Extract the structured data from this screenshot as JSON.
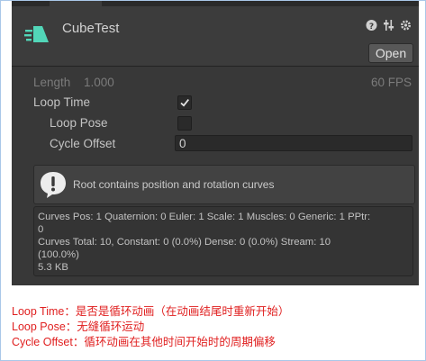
{
  "header": {
    "clip_name": "CubeTest",
    "clip_icon": "animation-clip-icon",
    "icons": [
      "help-icon",
      "preset-icon",
      "gear-icon"
    ],
    "open_label": "Open"
  },
  "length": {
    "label": "Length",
    "value": "1.000",
    "fps": "60 FPS"
  },
  "loop_time": {
    "label": "Loop Time",
    "checked": true
  },
  "loop_pose": {
    "label": "Loop Pose",
    "checked": false
  },
  "cycle_offset": {
    "label": "Cycle Offset",
    "value": "0"
  },
  "help": {
    "text": "Root contains position and rotation curves"
  },
  "info": {
    "line1": "Curves Pos: 1 Quaternion: 0 Euler: 1 Scale: 1 Muscles: 0 Generic: 1 PPtr:\n0",
    "line2": "Curves Total: 10, Constant: 0 (0.0%) Dense: 0 (0.0%) Stream: 10\n(100.0%)",
    "line3": "5.3 KB"
  },
  "notes": {
    "line1": "Loop Time：是否是循环动画（在动画结尾时重新开始）",
    "line2": "Loop Pose：无缝循环运动",
    "line3": "Cycle Offset：循环动画在其他时间开始时的周期偏移"
  },
  "colors": {
    "panel_bg": "#383838",
    "accent_icon": "#52d6b8",
    "note_red": "#e02020"
  }
}
